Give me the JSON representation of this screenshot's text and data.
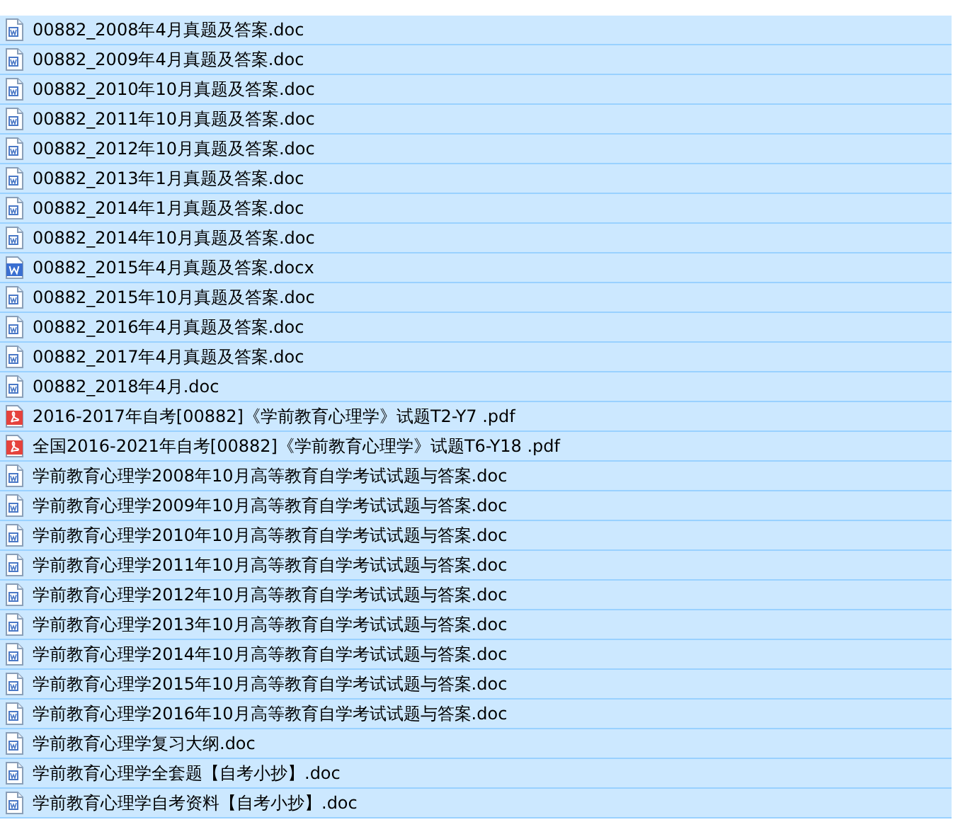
{
  "files": [
    {
      "name": "00882_2008年4月真题及答案.doc",
      "kind": "doc",
      "selected": true
    },
    {
      "name": "00882_2009年4月真题及答案.doc",
      "kind": "doc",
      "selected": true
    },
    {
      "name": "00882_2010年10月真题及答案.doc",
      "kind": "doc",
      "selected": true
    },
    {
      "name": "00882_2011年10月真题及答案.doc",
      "kind": "doc",
      "selected": true
    },
    {
      "name": "00882_2012年10月真题及答案.doc",
      "kind": "doc",
      "selected": true
    },
    {
      "name": "00882_2013年1月真题及答案.doc",
      "kind": "doc",
      "selected": true
    },
    {
      "name": "00882_2014年1月真题及答案.doc",
      "kind": "doc",
      "selected": true
    },
    {
      "name": "00882_2014年10月真题及答案.doc",
      "kind": "doc",
      "selected": true
    },
    {
      "name": "00882_2015年4月真题及答案.docx",
      "kind": "docx",
      "selected": true
    },
    {
      "name": "00882_2015年10月真题及答案.doc",
      "kind": "doc",
      "selected": true
    },
    {
      "name": "00882_2016年4月真题及答案.doc",
      "kind": "doc",
      "selected": true
    },
    {
      "name": "00882_2017年4月真题及答案.doc",
      "kind": "doc",
      "selected": true
    },
    {
      "name": "00882_2018年4月.doc",
      "kind": "doc",
      "selected": true
    },
    {
      "name": "2016-2017年自考[00882]《学前教育心理学》试题T2-Y7 .pdf",
      "kind": "pdf",
      "selected": true
    },
    {
      "name": "全国2016-2021年自考[00882]《学前教育心理学》试题T6-Y18 .pdf",
      "kind": "pdf",
      "selected": true
    },
    {
      "name": "学前教育心理学2008年10月高等教育自学考试试题与答案.doc",
      "kind": "doc",
      "selected": true
    },
    {
      "name": "学前教育心理学2009年10月高等教育自学考试试题与答案.doc",
      "kind": "doc",
      "selected": true
    },
    {
      "name": "学前教育心理学2010年10月高等教育自学考试试题与答案.doc",
      "kind": "doc",
      "selected": true
    },
    {
      "name": "学前教育心理学2011年10月高等教育自学考试试题与答案.doc",
      "kind": "doc",
      "selected": true
    },
    {
      "name": "学前教育心理学2012年10月高等教育自学考试试题与答案.doc",
      "kind": "doc",
      "selected": true
    },
    {
      "name": "学前教育心理学2013年10月高等教育自学考试试题与答案.doc",
      "kind": "doc",
      "selected": true
    },
    {
      "name": "学前教育心理学2014年10月高等教育自学考试试题与答案.doc",
      "kind": "doc",
      "selected": true
    },
    {
      "name": "学前教育心理学2015年10月高等教育自学考试试题与答案.doc",
      "kind": "doc",
      "selected": true
    },
    {
      "name": "学前教育心理学2016年10月高等教育自学考试试题与答案.doc",
      "kind": "doc",
      "selected": true
    },
    {
      "name": "学前教育心理学复习大纲.doc",
      "kind": "doc",
      "selected": true
    },
    {
      "name": "学前教育心理学全套题【自考小抄】.doc",
      "kind": "doc",
      "selected": true
    },
    {
      "name": "学前教育心理学自考资料【自考小抄】.doc",
      "kind": "doc",
      "selected": true
    }
  ]
}
